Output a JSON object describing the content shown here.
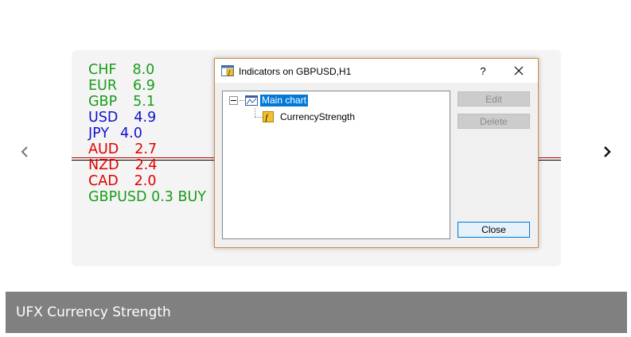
{
  "carousel": {
    "prev_icon": "chevron-left-icon",
    "next_icon": "chevron-right-icon"
  },
  "chart": {
    "currencies": [
      {
        "code": "CHF",
        "value": "8.0",
        "color": "#1a9c1a"
      },
      {
        "code": "EUR",
        "value": "6.9",
        "color": "#1a9c1a"
      },
      {
        "code": "GBP",
        "value": "5.1",
        "color": "#1a9c1a"
      },
      {
        "code": "USD",
        "value": "4.9",
        "color": "#1111cc"
      },
      {
        "code": "JPY",
        "value": "4.0",
        "color": "#1111cc"
      },
      {
        "code": "AUD",
        "value": "2.7",
        "color": "#e00000"
      },
      {
        "code": "NZD",
        "value": "2.4",
        "color": "#e00000"
      },
      {
        "code": "CAD",
        "value": "2.0",
        "color": "#e00000"
      }
    ],
    "summary": {
      "text": "GBPUSD 0.3 BUY",
      "color": "#1a9c1a"
    }
  },
  "dialog": {
    "title": "Indicators on GBPUSD,H1",
    "help_label": "?",
    "tree": {
      "root_label": "Main chart",
      "child_label": "CurrencyStrength"
    },
    "buttons": {
      "edit": "Edit",
      "delete": "Delete",
      "close": "Close"
    }
  },
  "caption": {
    "title": "UFX Currency Strength"
  }
}
